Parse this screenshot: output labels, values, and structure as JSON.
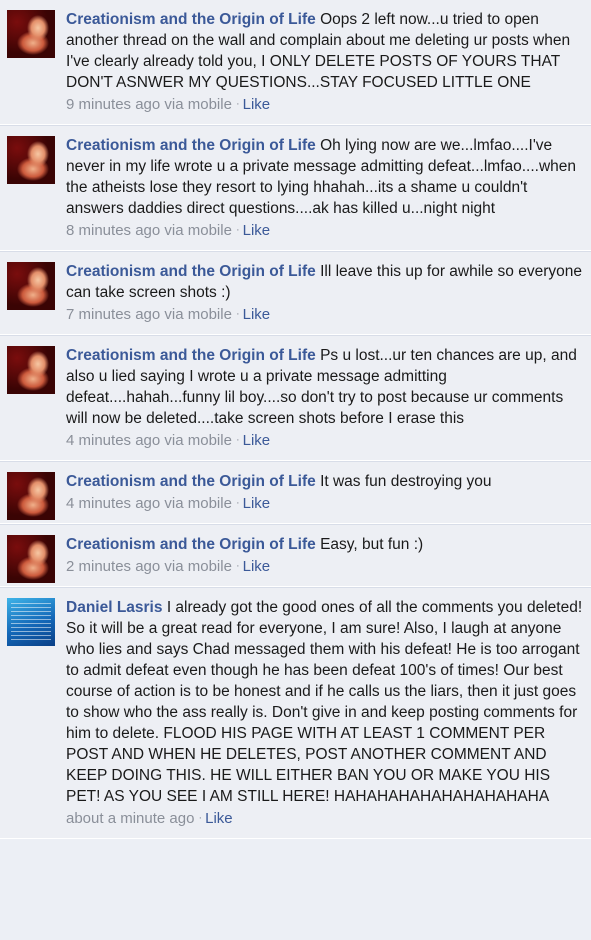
{
  "comments": [
    {
      "author": "Creationism and the Origin of Life",
      "avatar": "fetus-avatar",
      "body": "Oops 2 left now...u tried to open another thread on the wall and complain about me deleting ur posts when I've clearly already told you, I ONLY DELETE POSTS OF YOURS THAT DON'T ASNWER MY QUESTIONS...STAY FOCUSED LITTLE ONE",
      "time": "9 minutes ago via mobile",
      "like": "Like"
    },
    {
      "author": "Creationism and the Origin of Life",
      "avatar": "fetus-avatar",
      "body": "Oh lying now are we...lmfao....I've never in my life wrote u a private message admitting defeat...lmfao....when the atheists lose they resort to lying hhahah...its a shame u couldn't answers daddies direct questions....ak has killed u...night night",
      "time": "8 minutes ago via mobile",
      "like": "Like"
    },
    {
      "author": "Creationism and the Origin of Life",
      "avatar": "fetus-avatar",
      "body": "Ill leave this up for awhile so everyone can take screen shots :)",
      "time": "7 minutes ago via mobile",
      "like": "Like"
    },
    {
      "author": "Creationism and the Origin of Life",
      "avatar": "fetus-avatar",
      "body": "Ps u lost...ur ten chances are up, and also u lied saying I wrote u a private message admitting defeat....hahah...funny lil boy....so don't try to post because ur comments will now be deleted....take screen shots before I erase this",
      "time": "4 minutes ago via mobile",
      "like": "Like"
    },
    {
      "author": "Creationism and the Origin of Life",
      "avatar": "fetus-avatar",
      "body": "It was fun destroying you",
      "time": "4 minutes ago via mobile",
      "like": "Like"
    },
    {
      "author": "Creationism and the Origin of Life",
      "avatar": "fetus-avatar",
      "body": "Easy, but fun :)",
      "time": "2 minutes ago via mobile",
      "like": "Like"
    },
    {
      "author": "Daniel Lasris",
      "avatar": "poster-avatar",
      "body": "I already got the good ones of all the comments you deleted! So it will be a great read for everyone, I am sure! Also, I laugh at anyone who lies and says Chad messaged them with his defeat! He is too arrogant to admit defeat even though he has been defeat 100's of times! Our best course of action is to be honest and if he calls us the liars, then it just goes to show who the ass really is. Don't give in and keep posting comments for him to delete. FLOOD HIS PAGE WITH AT LEAST 1 COMMENT PER POST AND WHEN HE DELETES, POST ANOTHER COMMENT AND KEEP DOING THIS. HE WILL EITHER BAN YOU OR MAKE YOU HIS PET! AS YOU SEE I AM STILL HERE! HAHAHAHAHAHAHAHAHAHA",
      "time": "about a minute ago",
      "like": "Like"
    }
  ]
}
